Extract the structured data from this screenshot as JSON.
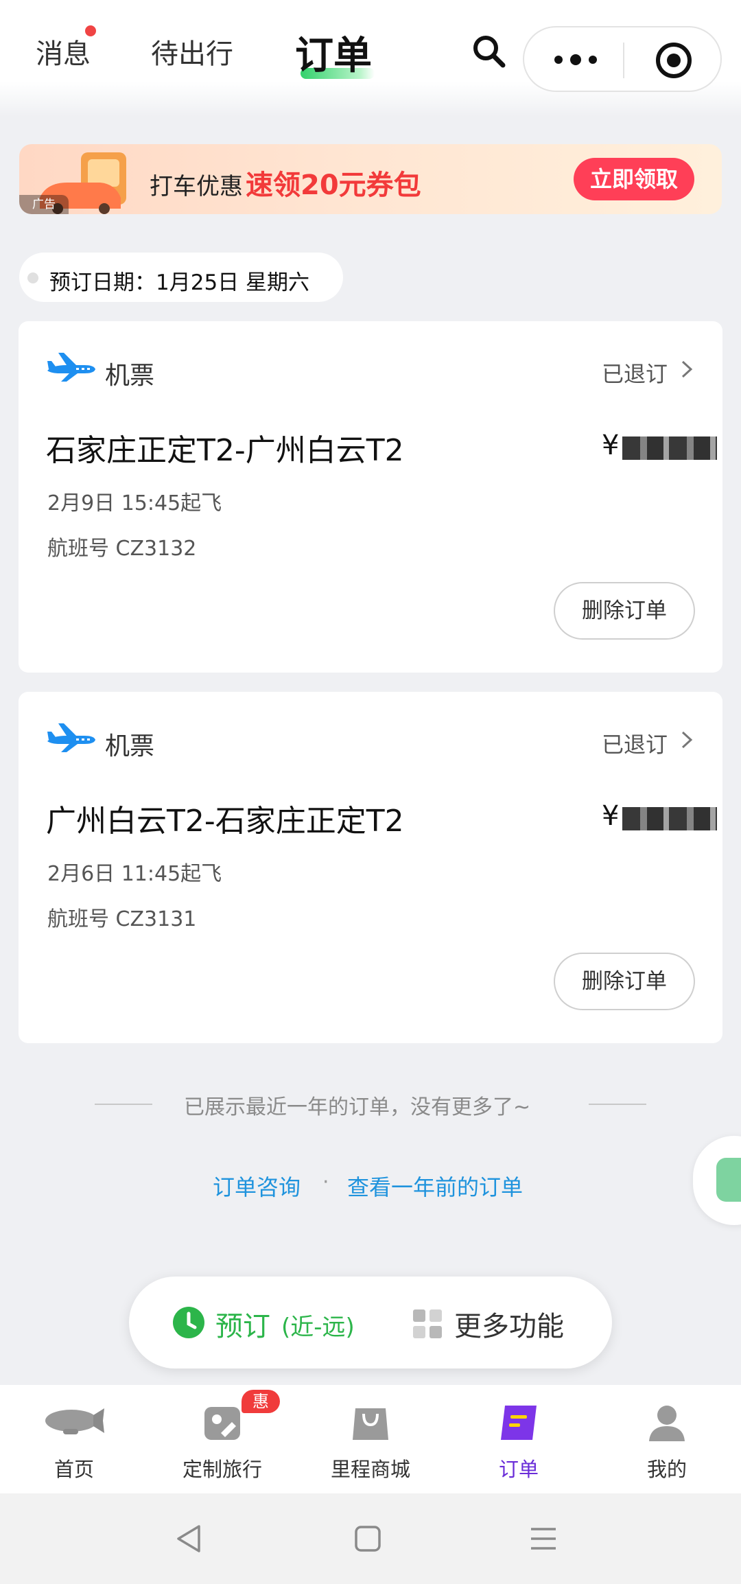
{
  "header": {
    "tabs": [
      {
        "label": "消息",
        "has_dot": true
      },
      {
        "label": "待出行"
      },
      {
        "label": "订单",
        "active": true
      }
    ],
    "search_icon": "search-icon",
    "more_icon": "more-dots-icon",
    "close_icon": "target-icon"
  },
  "ad_banner": {
    "tag": "广告",
    "text1": "打车优惠",
    "text2": "速领20元券包",
    "button": "立即领取"
  },
  "date_filter": {
    "label": "预订日期：1月25日 星期六"
  },
  "orders": [
    {
      "type": "机票",
      "status": "已退订",
      "route": "石家庄正定T2-广州白云T2",
      "price_prefix": "¥",
      "departure": "2月9日 15:45起飞",
      "flight": "航班号 CZ3132",
      "delete_button": "删除订单"
    },
    {
      "type": "机票",
      "status": "已退订",
      "route": "广州白云T2-石家庄正定T2",
      "price_prefix": "¥",
      "departure": "2月6日 11:45起飞",
      "flight": "航班号 CZ3131",
      "delete_button": "删除订单"
    }
  ],
  "footer": {
    "end_text": "已展示最近一年的订单，没有更多了~",
    "link1": "订单咨询",
    "separator": "·",
    "link2": "查看一年前的订单"
  },
  "floating_bar": {
    "book_label": "预订",
    "book_sub": "(近-远)",
    "more_label": "更多功能"
  },
  "bottom_nav": {
    "items": [
      {
        "label": "首页",
        "icon": "home-blimp-icon"
      },
      {
        "label": "定制旅行",
        "icon": "map-pin-icon",
        "badge": "惠"
      },
      {
        "label": "里程商城",
        "icon": "shopping-bag-icon"
      },
      {
        "label": "订单",
        "icon": "order-book-icon",
        "active": true
      },
      {
        "label": "我的",
        "icon": "user-icon"
      }
    ]
  },
  "colors": {
    "accent_green": "#2cb54a",
    "active_purple": "#6a2dd8",
    "link_blue": "#1f93dd",
    "ad_red": "#f23a3a"
  }
}
